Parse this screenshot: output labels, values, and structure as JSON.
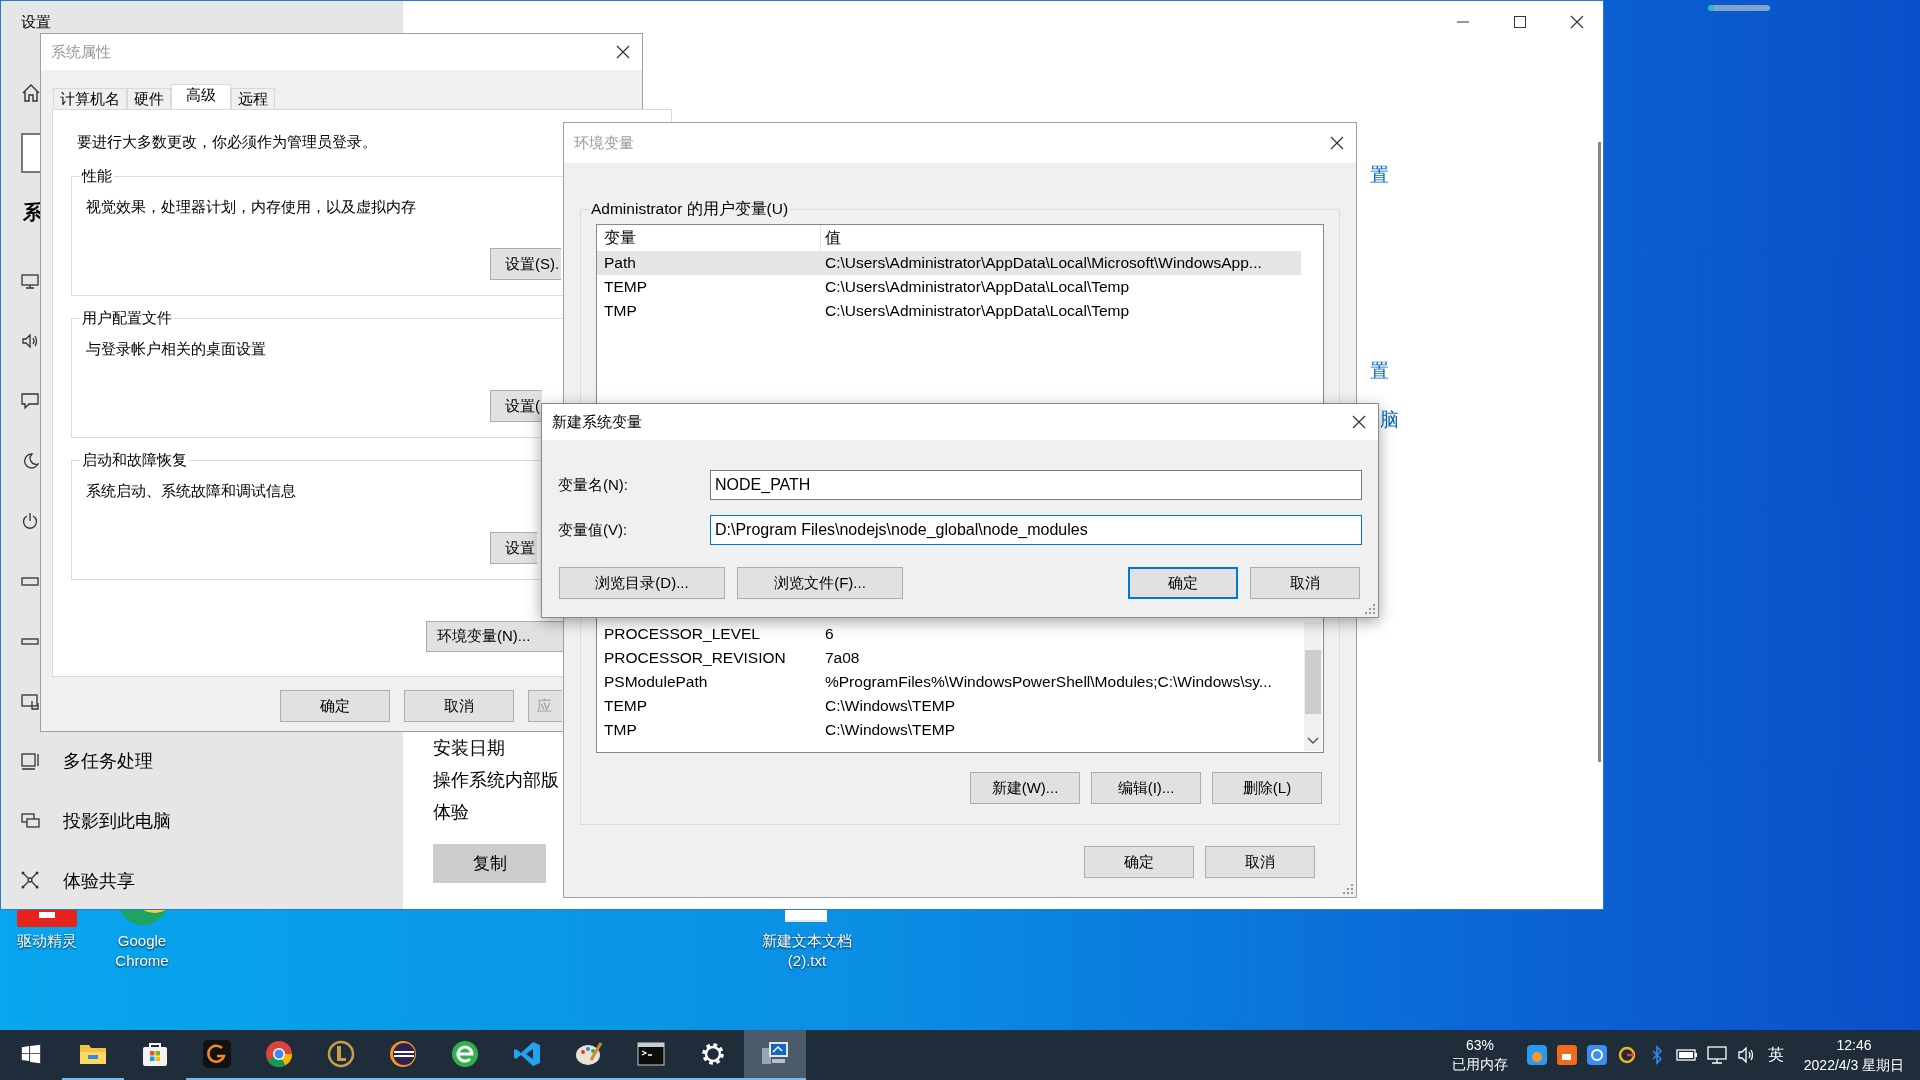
{
  "settings_window": {
    "title": "设置",
    "nav_heading": "系",
    "nav_items": [
      {
        "label": "多任务处理"
      },
      {
        "label": "投影到此电脑"
      },
      {
        "label": "体验共享"
      }
    ],
    "info_labels": [
      "安装日期",
      "操作系统内部版",
      "体验"
    ],
    "copy_button": "复制",
    "links": [
      "置",
      "置",
      "脑"
    ]
  },
  "system_properties": {
    "title": "系统属性",
    "tabs": [
      {
        "label": "计算机名",
        "selected": false
      },
      {
        "label": "硬件",
        "selected": false
      },
      {
        "label": "高级",
        "selected": true
      },
      {
        "label": "远程",
        "selected": false
      }
    ],
    "admin_note": "要进行大多数更改，你必须作为管理员登录。",
    "groups": [
      {
        "title": "性能",
        "description": "视觉效果，处理器计划，内存使用，以及虚拟内存",
        "button": "设置(S)."
      },
      {
        "title": "用户配置文件",
        "description": "与登录帐户相关的桌面设置",
        "button": "设置("
      },
      {
        "title": "启动和故障恢复",
        "description": "系统启动、系统故障和调试信息",
        "button": "设置"
      }
    ],
    "env_button": "环境变量(N)...",
    "buttons": [
      {
        "label": "确定",
        "disabled": false
      },
      {
        "label": "取消",
        "disabled": false
      },
      {
        "label": "应",
        "disabled": true
      }
    ]
  },
  "environment_variables": {
    "title": "环境变量",
    "user_group": "Administrator 的用户变量(U)",
    "user_table": {
      "columns": [
        "变量",
        "值"
      ],
      "rows": [
        {
          "name": "Path",
          "value": "C:\\Users\\Administrator\\AppData\\Local\\Microsoft\\WindowsApp...",
          "selected": true
        },
        {
          "name": "TEMP",
          "value": "C:\\Users\\Administrator\\AppData\\Local\\Temp",
          "selected": false
        },
        {
          "name": "TMP",
          "value": "C:\\Users\\Administrator\\AppData\\Local\\Temp",
          "selected": false
        }
      ]
    },
    "system_table": {
      "rows": [
        {
          "name": "PROCESSOR_LEVEL",
          "value": "6",
          "selected": false
        },
        {
          "name": "PROCESSOR_REVISION",
          "value": "7a08",
          "selected": false
        },
        {
          "name": "PSModulePath",
          "value": "%ProgramFiles%\\WindowsPowerShell\\Modules;C:\\Windows\\sy...",
          "selected": false
        },
        {
          "name": "TEMP",
          "value": "C:\\Windows\\TEMP",
          "selected": false
        },
        {
          "name": "TMP",
          "value": "C:\\Windows\\TEMP",
          "selected": false
        }
      ]
    },
    "system_buttons": [
      "新建(W)...",
      "编辑(I)...",
      "删除(L)"
    ],
    "buttons": [
      "确定",
      "取消"
    ]
  },
  "new_variable_dialog": {
    "title": "新建系统变量",
    "fields": [
      {
        "label": "变量名(N):",
        "value": "NODE_PATH",
        "focused": false
      },
      {
        "label": "变量值(V):",
        "value": "D:\\Program Files\\nodejs\\node_global\\node_modules",
        "focused": true
      }
    ],
    "buttons": [
      {
        "label": "浏览目录(D)...",
        "default": false
      },
      {
        "label": "浏览文件(F)...",
        "default": false
      },
      {
        "label": "确定",
        "default": true
      },
      {
        "label": "取消",
        "default": false
      }
    ]
  },
  "desktop": {
    "icons": [
      {
        "label": "驱动精灵"
      },
      {
        "label": "Google Chrome"
      },
      {
        "label": "新建文本文档 (2).txt"
      }
    ],
    "slider": {
      "level": 0.1
    }
  },
  "taskbar": {
    "apps": [
      {
        "running": false,
        "active": false
      },
      {
        "running": true,
        "active": false
      },
      {
        "running": false,
        "active": false
      },
      {
        "running": true,
        "active": false
      },
      {
        "running": true,
        "active": false
      },
      {
        "running": true,
        "active": false
      },
      {
        "running": true,
        "active": false
      },
      {
        "running": true,
        "active": false
      },
      {
        "running": true,
        "active": false
      },
      {
        "running": true,
        "active": false
      },
      {
        "running": true,
        "active": false
      },
      {
        "running": true,
        "active": false
      },
      {
        "running": true,
        "active": true
      }
    ],
    "memory_percent": "63%",
    "memory_label": "已用内存",
    "ime": "英",
    "time": "12:46",
    "date": "2022/4/3 星期日"
  }
}
